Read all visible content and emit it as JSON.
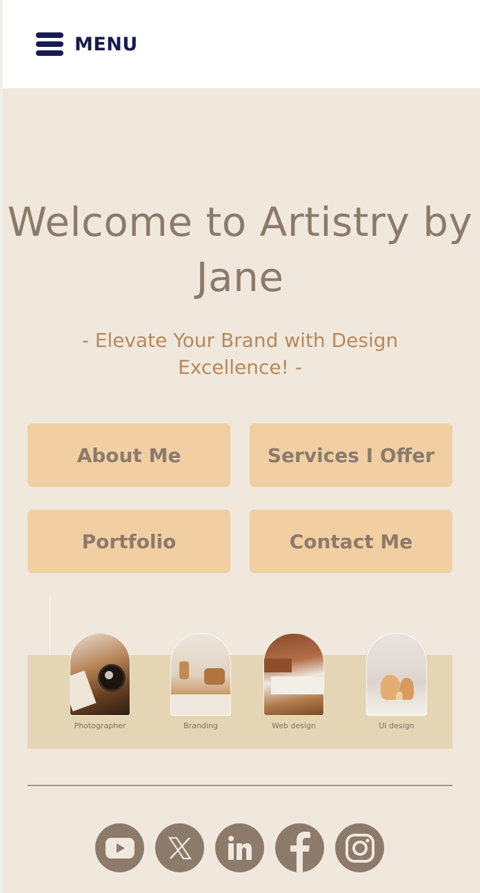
{
  "header": {
    "menu_label": "MENU",
    "menu_icon": "hamburger-icon"
  },
  "hero": {
    "title": "Welcome to Artistry by Jane",
    "tagline": "- Elevate Your Brand with Design Excellence! -"
  },
  "nav_buttons": [
    {
      "label": "About Me"
    },
    {
      "label": "Services I Offer"
    },
    {
      "label": "Portfolio"
    },
    {
      "label": "Contact Me"
    }
  ],
  "services": [
    {
      "label": "Photographer",
      "image": "camera-photo"
    },
    {
      "label": "Branding",
      "image": "candles-interior-photo"
    },
    {
      "label": "Web design",
      "image": "living-room-photo"
    },
    {
      "label": "UI design",
      "image": "vases-photo"
    }
  ],
  "social_links": [
    {
      "name": "YouTube",
      "icon": "youtube-icon"
    },
    {
      "name": "X",
      "icon": "x-icon"
    },
    {
      "name": "LinkedIn",
      "icon": "linkedin-icon"
    },
    {
      "name": "Facebook",
      "icon": "facebook-icon"
    },
    {
      "name": "Instagram",
      "icon": "instagram-icon"
    }
  ],
  "colors": {
    "background": "#f0e8dc",
    "header_bg": "#ffffff",
    "menu_color": "#161c4f",
    "title_color": "#8c7a6b",
    "tagline_color": "#b8875a",
    "button_bg": "#f1cfa2",
    "services_band": "#e4d5b5",
    "divider": "#b98d64",
    "social_bg": "#8c7a6b"
  }
}
